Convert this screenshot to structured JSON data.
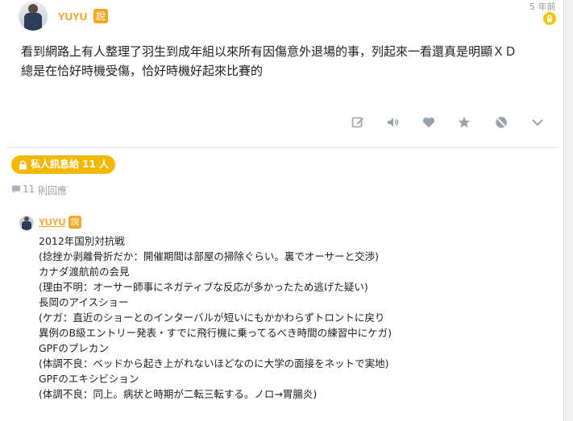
{
  "post": {
    "author": "YUYU",
    "author_tag": "說",
    "time": "5 年前",
    "lines": [
      "看到網路上有人整理了羽生到成年組以來所有因傷意外退場的事，列起來一看還真是明顯ＸＤ",
      "總是在恰好時機受傷，恰好時機好起來比賽的"
    ]
  },
  "actions": {
    "icons": [
      "edit-icon",
      "speaker-icon",
      "heart-icon",
      "star-icon",
      "block-icon",
      "chevron-down-icon"
    ]
  },
  "private_pill": {
    "label": "私人訊息給 11 人"
  },
  "replies": {
    "count": "11",
    "label": "則回應"
  },
  "reply": {
    "author": "YUYU",
    "author_tag": "說",
    "lines": [
      "2012年国別対抗戦",
      "(捻挫か剥離骨折だか：開催期間は部屋の掃除ぐらい。裏でオーサーと交渉)",
      "カナダ渡航前の会見",
      "(理由不明：オーサー師事にネガティブな反応が多かったため逃げた疑い)",
      "長岡のアイスショー",
      "(ケガ：直近のショーとのインターバルが短いにもかかわらずトロントに戻り",
      "異例のB級エントリー発表・すでに飛行機に乗ってるべき時間の練習中にケガ)",
      "GPFのプレカン",
      "(体調不良：ベッドから起き上がれないほどなのに大学の面接をネットで実地)",
      "GPFのエキシビション",
      "(体調不良：同上。病状と時期が二転三転する。ノロ→胃腸炎)"
    ]
  },
  "colors": {
    "accent": "#f5a623",
    "author": "#f0a020",
    "pill": "#f5b800",
    "icon": "#9aa3ad"
  }
}
